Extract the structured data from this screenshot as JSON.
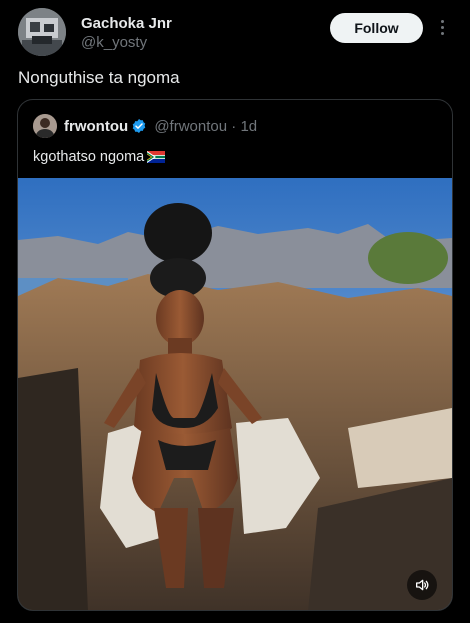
{
  "post": {
    "author": {
      "name": "Gachoka Jnr",
      "handle": "@k_yosty"
    },
    "follow_label": "Follow",
    "text": "Nonguthise ta ngoma"
  },
  "quoted": {
    "author": {
      "name": "frwontou",
      "handle": "@frwontou"
    },
    "separator": "·",
    "time": "1d",
    "text": "kgothatso ngoma",
    "media_icon": "volume-icon"
  },
  "colors": {
    "background": "#000000",
    "text_primary": "#e7e9ea",
    "text_secondary": "#71767b",
    "verified": "#1d9bf0",
    "border": "#2f3336"
  }
}
